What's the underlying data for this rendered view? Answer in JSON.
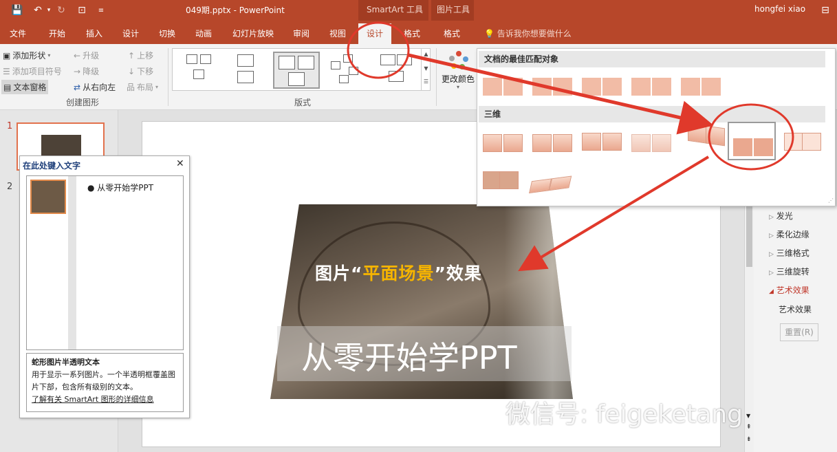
{
  "window": {
    "doc_title": "049期.pptx - PowerPoint",
    "user": "hongfei xiao",
    "contexts": [
      "SmartArt 工具",
      "图片工具"
    ]
  },
  "tabs": [
    {
      "label": "文件"
    },
    {
      "label": "开始"
    },
    {
      "label": "插入"
    },
    {
      "label": "设计"
    },
    {
      "label": "切换"
    },
    {
      "label": "动画"
    },
    {
      "label": "幻灯片放映"
    },
    {
      "label": "审阅"
    },
    {
      "label": "视图"
    },
    {
      "label": "设计",
      "active": true
    },
    {
      "label": "格式"
    },
    {
      "label": "格式"
    }
  ],
  "tellme": "告诉我你想要做什么",
  "ribbon": {
    "create": {
      "add_shape": "添加形状",
      "add_bullet": "添加项目符号",
      "text_pane": "文本窗格",
      "promote": "升级",
      "demote": "降级",
      "rtl": "从右向左",
      "move_up": "上移",
      "move_down": "下移",
      "layout": "布局",
      "group_label": "创建图形"
    },
    "layouts_label": "版式",
    "change_colors": "更改颜色"
  },
  "styles_dropdown": {
    "section_best": "文档的最佳匹配对象",
    "section_3d": "三维"
  },
  "slides_panel": {
    "numbers": [
      "1",
      "2"
    ]
  },
  "text_pane": {
    "title": "在此处键入文字",
    "bullet": "从零开始学PPT",
    "desc_title": "蛇形图片半透明文本",
    "desc_body": "用于显示一系列图片。一个半透明框覆盖图片下部，包含所有级别的文本。",
    "learn_more": "了解有关 SmartArt 图形的详细信息"
  },
  "slide": {
    "title_prefix": "图片“",
    "title_highlight": "平面场景",
    "title_suffix": "”效果",
    "banner": "从零开始学PPT"
  },
  "format_pane": {
    "items": [
      "发光",
      "柔化边缘",
      "三维格式",
      "三维旋转",
      "艺术效果",
      "艺术效果"
    ],
    "reset": "重置(R)"
  },
  "watermark": "微信号: feigeketang",
  "colors": {
    "accent": "#b7472a",
    "annotation": "#e0392b",
    "highlight": "#f6b400"
  }
}
